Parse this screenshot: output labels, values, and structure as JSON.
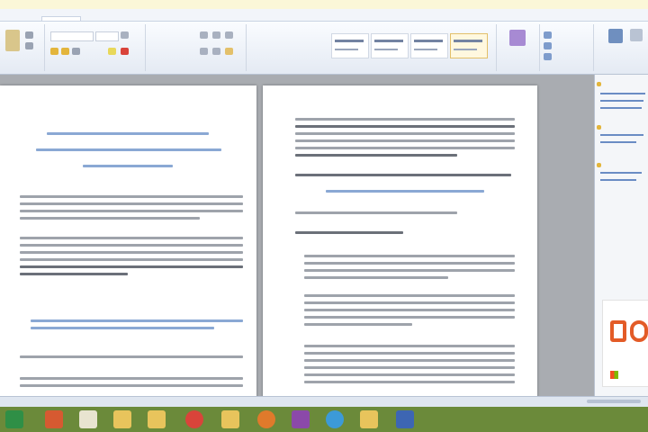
{
  "window": {
    "title": ""
  },
  "tabs": [
    {
      "label": "",
      "active": false
    },
    {
      "label": "",
      "active": true
    },
    {
      "label": "",
      "active": false
    },
    {
      "label": "",
      "active": false
    },
    {
      "label": "",
      "active": false
    }
  ],
  "ribbon": {
    "font_name": "",
    "font_size": "",
    "groups": [
      "",
      "",
      "",
      "",
      ""
    ]
  },
  "document": {
    "page1_heading": "",
    "page2_subheading": ""
  },
  "pane": {
    "headers": [
      "",
      "",
      ""
    ]
  },
  "colors": {
    "accent": "#4d7ab9",
    "taskbar": "#6b8a3a",
    "office_logo": "#e35b27"
  },
  "taskbar": {
    "apps": [
      "excel-icon",
      "powerpoint-icon",
      "explorer-icon",
      "folder-icon",
      "chrome-icon",
      "folder-icon",
      "firefox-icon",
      "onenote-icon",
      "skype-icon",
      "folder-icon",
      "word-icon"
    ]
  }
}
